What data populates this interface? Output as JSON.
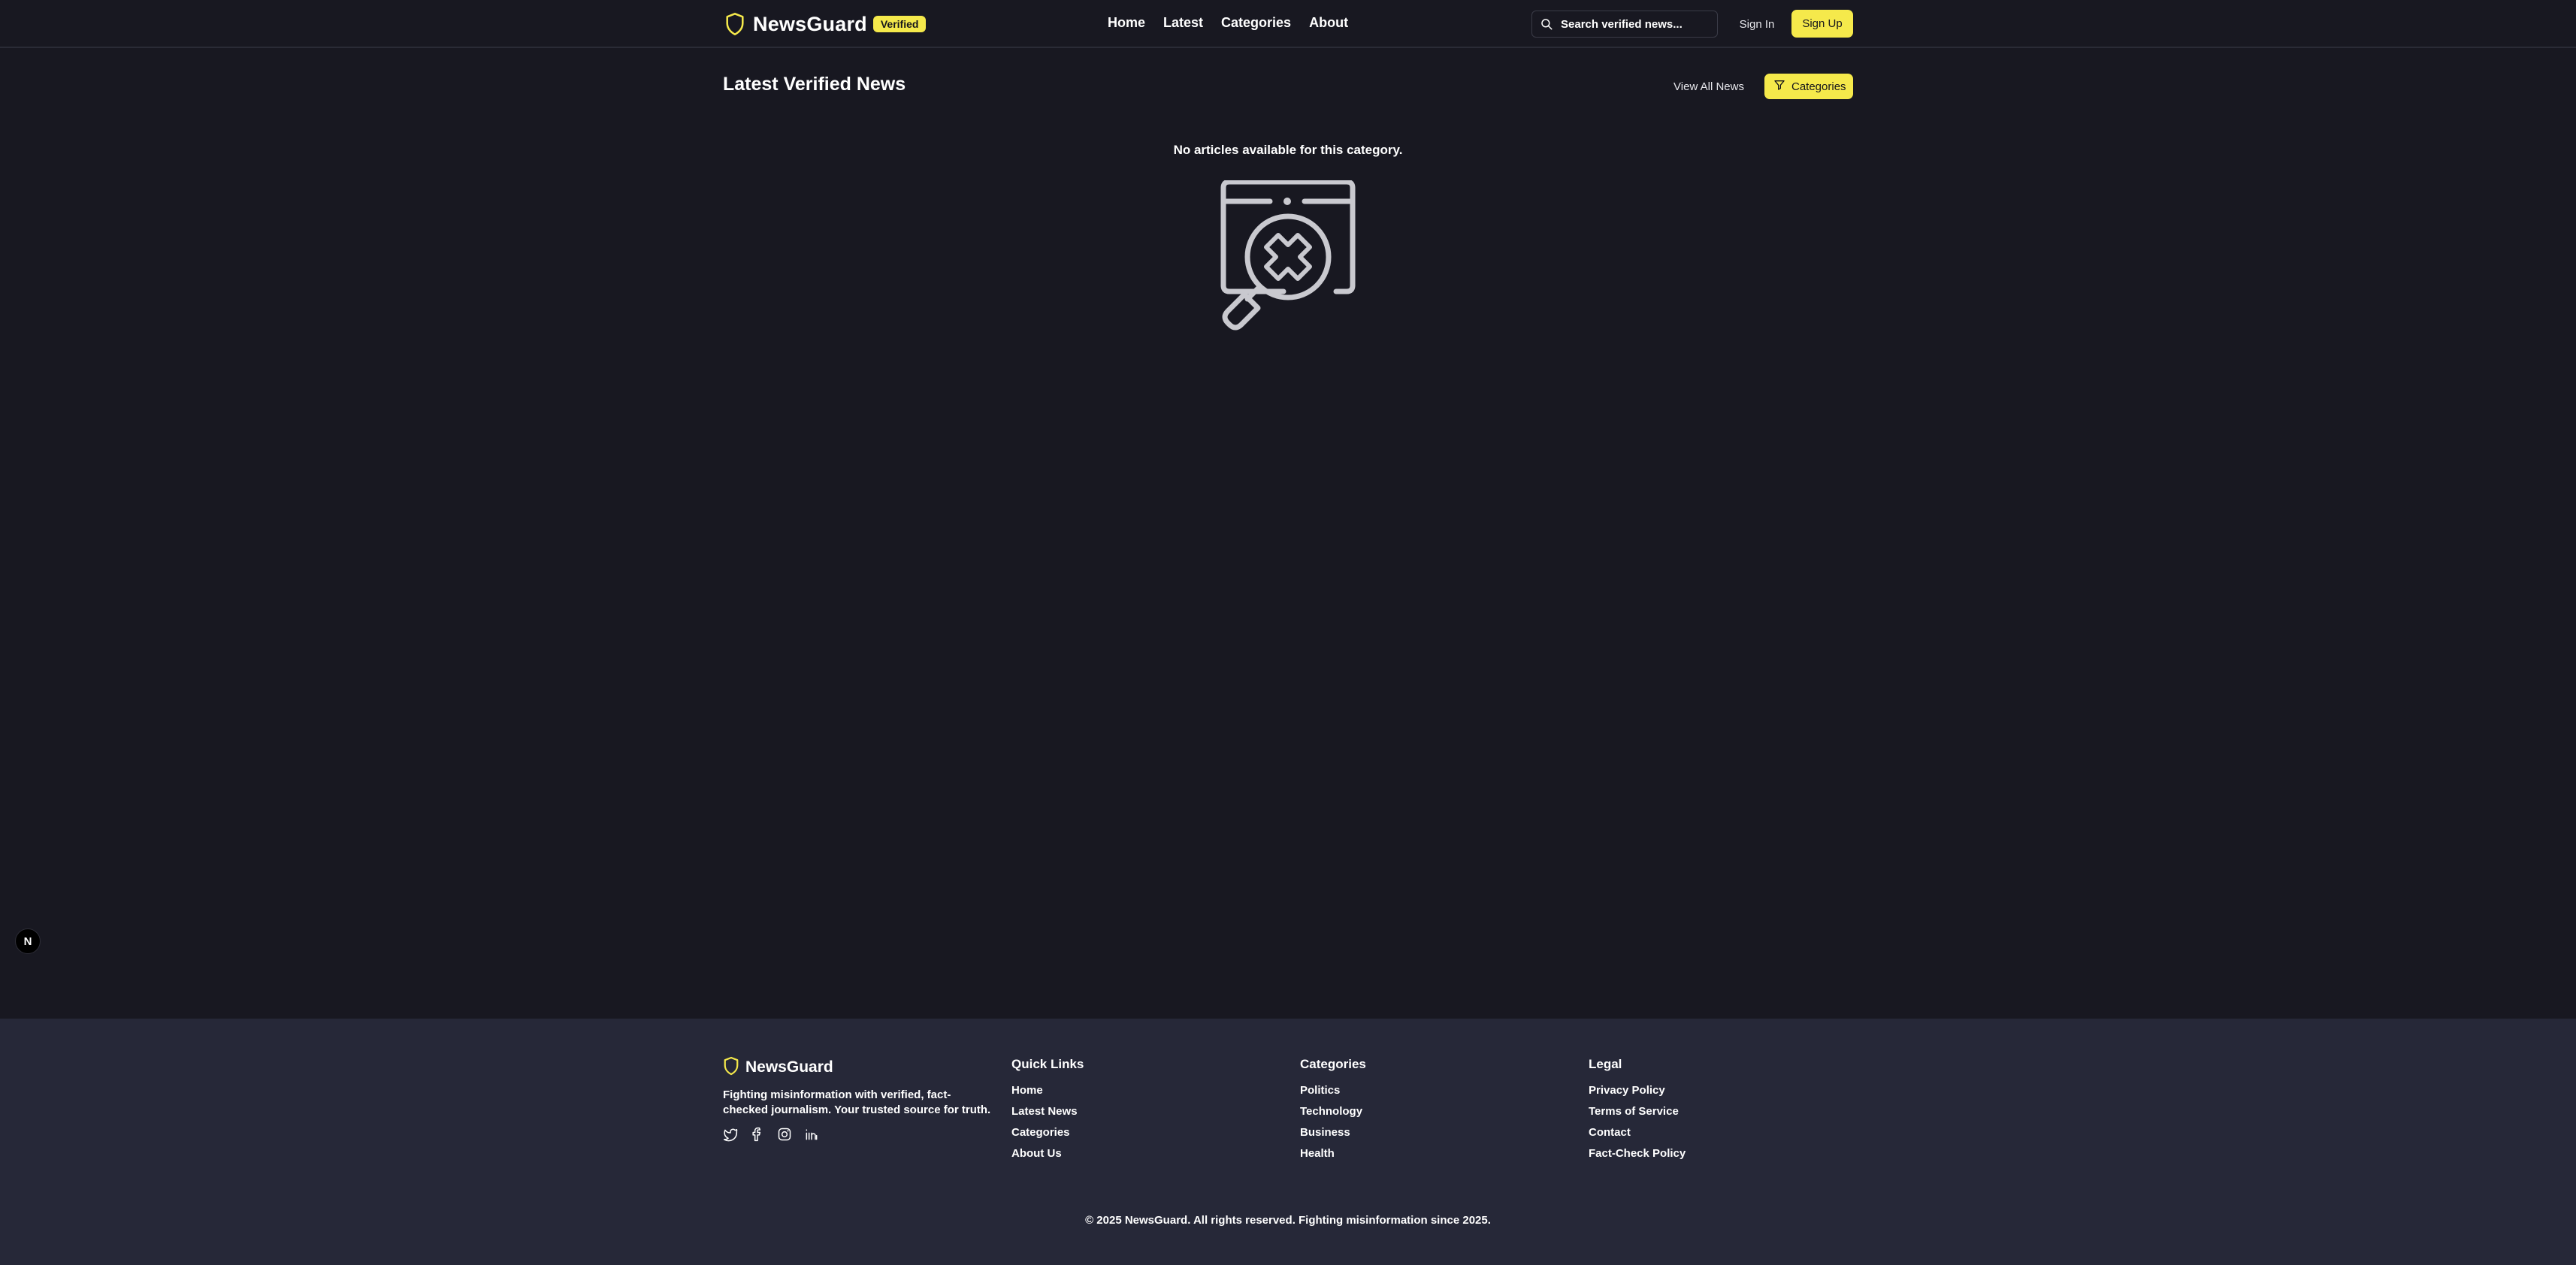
{
  "colors": {
    "background": "#181821",
    "footer_background": "#262838",
    "accent": "#f5e94b",
    "text": "#ffffff",
    "icon_gray": "#c9c9cf"
  },
  "header": {
    "brand_name": "NewsGuard",
    "brand_icon": "shield-icon",
    "badge": "Verified",
    "nav": [
      "Home",
      "Latest",
      "Categories",
      "About"
    ],
    "search_placeholder": "Search verified news...",
    "search_icon": "search-icon",
    "sign_in": "Sign In",
    "sign_up": "Sign Up"
  },
  "main": {
    "title": "Latest Verified News",
    "view_all": "View All News",
    "categories_button": "Categories",
    "categories_icon": "filter-icon",
    "empty_message": "No articles available for this category.",
    "empty_icon": "search-not-found-icon"
  },
  "corner_badge": "N",
  "footer": {
    "brand_name": "NewsGuard",
    "description": "Fighting misinformation with verified, fact-checked journalism. Your trusted source for truth.",
    "socials": [
      "twitter-icon",
      "facebook-icon",
      "instagram-icon",
      "linkedin-icon"
    ],
    "columns": [
      {
        "heading": "Quick Links",
        "links": [
          "Home",
          "Latest News",
          "Categories",
          "About Us"
        ]
      },
      {
        "heading": "Categories",
        "links": [
          "Politics",
          "Technology",
          "Business",
          "Health"
        ]
      },
      {
        "heading": "Legal",
        "links": [
          "Privacy Policy",
          "Terms of Service",
          "Contact",
          "Fact-Check Policy"
        ]
      }
    ],
    "copyright": "© 2025 NewsGuard. All rights reserved. Fighting misinformation since 2025."
  }
}
